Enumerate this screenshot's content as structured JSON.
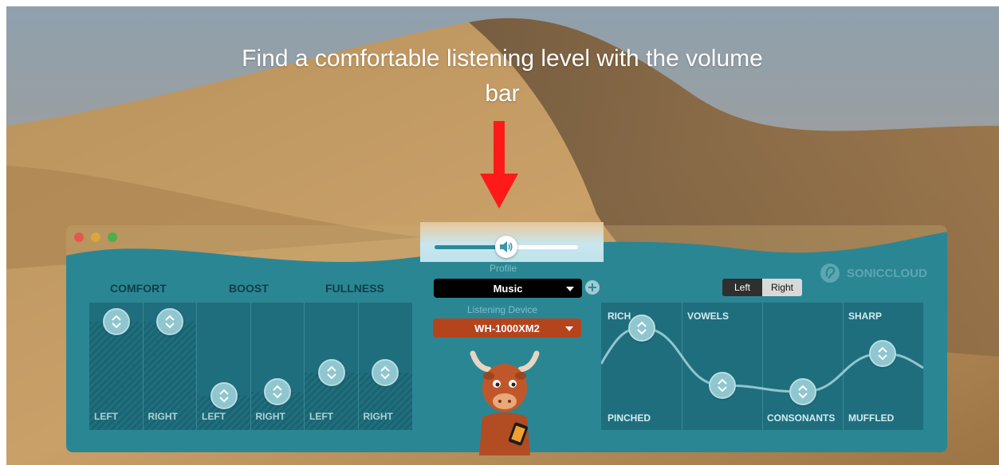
{
  "instruction": {
    "line1": "Find a comfortable listening level with the volume",
    "line2": "bar"
  },
  "colors": {
    "arrow": "#ff1a1a",
    "app_teal": "#2b8694",
    "profile_dropdown": "#000000",
    "device_dropdown": "#b5441d"
  },
  "volume": {
    "level": 0.5,
    "icon": "speaker-icon"
  },
  "app": {
    "window_controls": [
      "close",
      "minimize",
      "zoom"
    ],
    "profile_label": "Profile",
    "profile_value": "Music",
    "add_profile_icon": "plus-icon",
    "device_label": "Listening Device",
    "device_value": "WH-1000XM2",
    "mascot": "bull-mascot",
    "brand": "SONICCLOUD",
    "ear_toggle": {
      "left": "Left",
      "right": "Right",
      "selected": "Right"
    }
  },
  "left_panel": {
    "headers": [
      "COMFORT",
      "BOOST",
      "FULLNESS"
    ],
    "columns": [
      {
        "label": "LEFT",
        "level": 0.85
      },
      {
        "label": "RIGHT",
        "level": 0.85
      },
      {
        "label": "LEFT",
        "level": 0.27
      },
      {
        "label": "RIGHT",
        "level": 0.3
      },
      {
        "label": "LEFT",
        "level": 0.45
      },
      {
        "label": "RIGHT",
        "level": 0.45
      }
    ]
  },
  "right_panel": {
    "top_labels": [
      "RICH",
      "VOWELS",
      "SHARP"
    ],
    "bottom_labels": [
      "PINCHED",
      "CONSONANTS",
      "MUFFLED"
    ],
    "bands": [
      0.8,
      0.35,
      0.3,
      0.6
    ]
  }
}
